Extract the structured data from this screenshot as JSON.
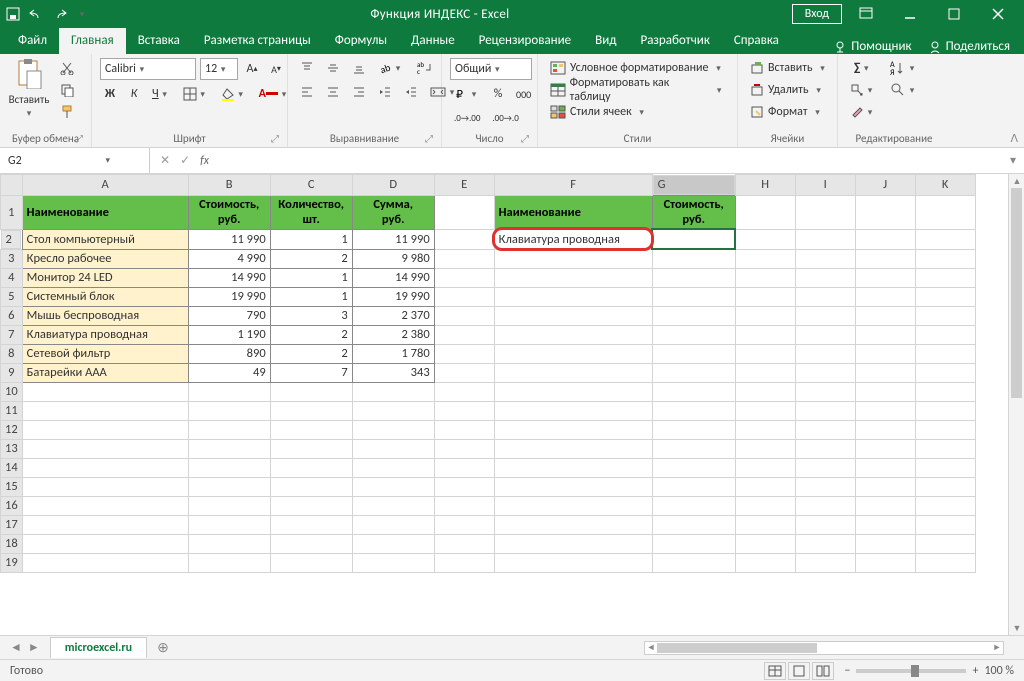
{
  "app": {
    "title": "Функция ИНДЕКС  -  Excel",
    "login": "Вход"
  },
  "tabs": {
    "items": [
      "Файл",
      "Главная",
      "Вставка",
      "Разметка страницы",
      "Формулы",
      "Данные",
      "Рецензирование",
      "Вид",
      "Разработчик",
      "Справка"
    ],
    "active": 1,
    "help": "Помощник",
    "share": "Поделиться"
  },
  "ribbon": {
    "clipboard": {
      "label": "Буфер обмена",
      "paste": "Вставить"
    },
    "font": {
      "label": "Шрифт",
      "name": "Calibri",
      "size": "12",
      "bold": "Ж",
      "italic": "К",
      "underline": "Ч"
    },
    "align": {
      "label": "Выравнивание"
    },
    "number": {
      "label": "Число",
      "format": "Общий"
    },
    "styles": {
      "label": "Стили",
      "cond": "Условное форматирование",
      "table": "Форматировать как таблицу",
      "cell": "Стили ячеек"
    },
    "cells": {
      "label": "Ячейки",
      "insert": "Вставить",
      "delete": "Удалить",
      "format": "Формат"
    },
    "editing": {
      "label": "Редактирование"
    }
  },
  "formula": {
    "cellref": "G2",
    "value": ""
  },
  "grid": {
    "cols": [
      "A",
      "B",
      "C",
      "D",
      "E",
      "F",
      "G",
      "H",
      "I",
      "J",
      "K"
    ],
    "headers1": [
      "Наименование",
      "Стоимость, руб.",
      "Количество, шт.",
      "Сумма, руб."
    ],
    "rows": [
      {
        "a": "Стол компьютерный",
        "b": "11 990",
        "c": "1",
        "d": "11 990"
      },
      {
        "a": "Кресло рабочее",
        "b": "4 990",
        "c": "2",
        "d": "9 980"
      },
      {
        "a": "Монитор 24 LED",
        "b": "14 990",
        "c": "1",
        "d": "14 990"
      },
      {
        "a": "Системный блок",
        "b": "19 990",
        "c": "1",
        "d": "19 990"
      },
      {
        "a": "Мышь беспроводная",
        "b": "790",
        "c": "3",
        "d": "2 370"
      },
      {
        "a": "Клавиатура проводная",
        "b": "1 190",
        "c": "2",
        "d": "2 380"
      },
      {
        "a": "Сетевой фильтр",
        "b": "890",
        "c": "2",
        "d": "1 780"
      },
      {
        "a": "Батарейки ААА",
        "b": "49",
        "c": "7",
        "d": "343"
      }
    ],
    "headers2": {
      "f": "Наименование",
      "g": "Стоимость, руб."
    },
    "f2": "Клавиатура проводная",
    "blankrows": 10
  },
  "sheet": {
    "name": "microexcel.ru"
  },
  "status": {
    "ready": "Готово",
    "zoom": "100 %"
  }
}
